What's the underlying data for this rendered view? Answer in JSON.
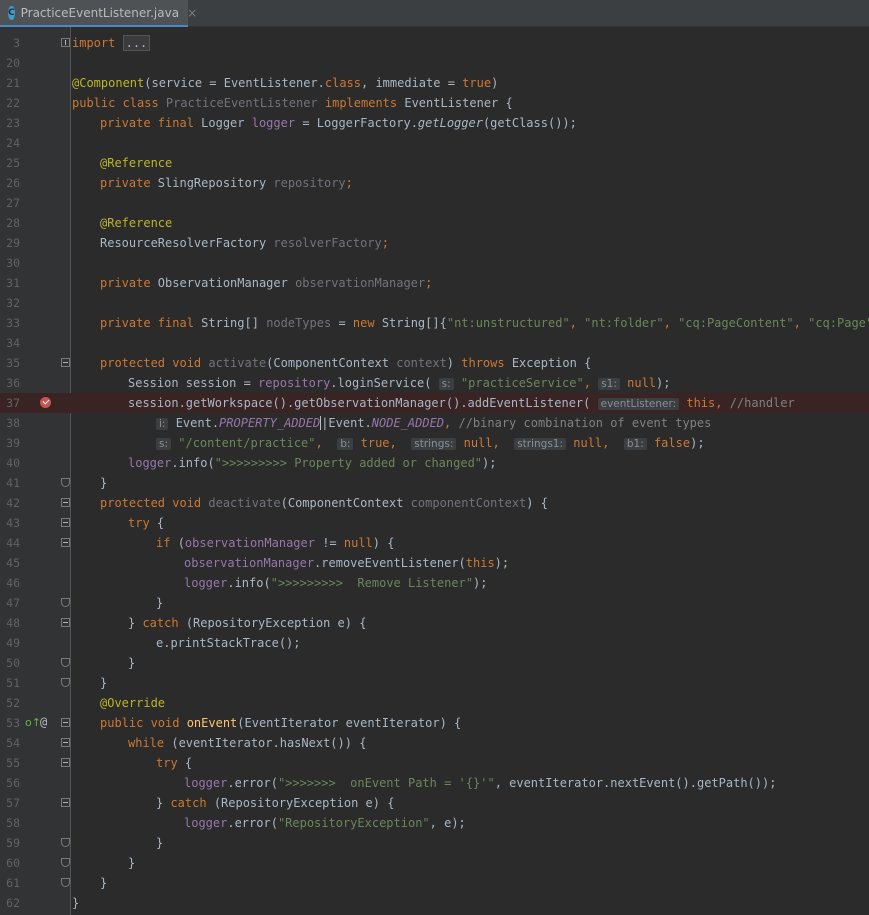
{
  "tab": {
    "icon_letter": "C",
    "filename": "PracticeEventListener.java",
    "close_glyph": "×"
  },
  "colors": {
    "keyword": "#cc7832",
    "annotation": "#bbb529",
    "string": "#6a8759",
    "field": "#9876aa",
    "method_decl": "#ffc66d",
    "comment": "#808080",
    "breakpoint": "#c75450"
  },
  "gutter_icons": {
    "line37": "breakpoint-icon",
    "line53": [
      "implementation-icon",
      "override-icon"
    ]
  },
  "line_numbers": [
    "3",
    "20",
    "21",
    "22",
    "23",
    "24",
    "25",
    "26",
    "27",
    "28",
    "29",
    "30",
    "31",
    "32",
    "33",
    "34",
    "35",
    "36",
    "37",
    "38",
    "39",
    "40",
    "41",
    "42",
    "43",
    "44",
    "45",
    "46",
    "47",
    "48",
    "49",
    "50",
    "51",
    "52",
    "53",
    "54",
    "55",
    "56",
    "57",
    "58",
    "59",
    "60",
    "61",
    "62"
  ],
  "code": {
    "l3": {
      "kw": "import",
      "folded": "..."
    },
    "l21": {
      "ann": "@Component",
      "a": "(service = EventListener.",
      "kw1": "class",
      "b": ", immediate = ",
      "kw2": "true",
      "c": ")"
    },
    "l22": {
      "kw1": "public class ",
      "cls": "PracticeEventListener",
      "kw2": " implements ",
      "rest": "EventListener {"
    },
    "l23": {
      "kw": "private final ",
      "a": "Logger ",
      "fld": "logger",
      "b": " = LoggerFactory.",
      "itl": "getLogger",
      "c": "(getClass());"
    },
    "l25": {
      "ann": "@Reference"
    },
    "l26": {
      "kw": "private ",
      "a": "SlingRepository ",
      "unused": "repository",
      "b": ";"
    },
    "l28": {
      "ann": "@Reference"
    },
    "l29": {
      "a": "ResourceResolverFactory ",
      "unused": "resolverFactory",
      "b": ";"
    },
    "l31": {
      "kw": "private ",
      "a": "ObservationManager ",
      "unused": "observationManager",
      "b": ";"
    },
    "l33": {
      "kw1": "private final ",
      "a": "String[] ",
      "unused": "nodeTypes",
      "b": " = ",
      "kw2": "new ",
      "c": "String[]{",
      "s1": "\"nt:unstructured\"",
      "d": ", ",
      "s2": "\"nt:folder\"",
      "e": ", ",
      "s3": "\"cq:PageContent\"",
      "f": ", ",
      "s4": "\"cq:Page\"",
      "g": "};"
    },
    "l35": {
      "kw1": "protected void ",
      "unused1": "activate",
      "a": "(ComponentContext ",
      "unused2": "context",
      "b": ") ",
      "kw2": "throws ",
      "c": "Exception {"
    },
    "l36": {
      "a": "Session session = ",
      "fld": "repository",
      "b": ".loginService( ",
      "h1": "s:",
      "s1": " \"practiceService\"",
      "c": ", ",
      "h2": "s1:",
      "kw": " null",
      "d": ");"
    },
    "l37": {
      "a": "session.getWorkspace().getObservationManager().addEventListener( ",
      "h1": "eventListener:",
      "kw": " this",
      "b": ", ",
      "cmt": "//handler"
    },
    "l38": {
      "h1": "i:",
      "a": " Event.",
      "fld1": "PROPERTY_ADDED",
      "b": "|Event.",
      "fld2": "NODE_ADDED",
      "c": ", ",
      "cmt": "//binary combination of event types"
    },
    "l39": {
      "h1": "s:",
      "s1": " \"/content/practice\"",
      "a": ",  ",
      "h2": "b:",
      "kw1": " true",
      "b": ",  ",
      "h3": "strings:",
      "kw2": " null",
      "c": ",  ",
      "h4": "strings1:",
      "kw3": " null",
      "d": ",  ",
      "h5": "b1:",
      "kw4": " false",
      "e": ");"
    },
    "l40": {
      "fld": "logger",
      "a": ".info(",
      "s1": "\">>>>>>>>> Property added or changed\"",
      "b": ");"
    },
    "l41": {
      "a": "}"
    },
    "l42": {
      "kw": "protected void ",
      "unused1": "deactivate",
      "a": "(ComponentContext ",
      "unused2": "componentContext",
      "b": ") {"
    },
    "l43": {
      "kw": "try ",
      "a": "{"
    },
    "l44": {
      "kw1": "if ",
      "a": "(",
      "fld": "observationManager",
      "b": " != ",
      "kw2": "null",
      "c": ") {"
    },
    "l45": {
      "fld": "observationManager",
      "a": ".removeEventListener(",
      "kw": "this",
      "b": ");"
    },
    "l46": {
      "fld": "logger",
      "a": ".info(",
      "s1": "\">>>>>>>>>  Remove Listener\"",
      "b": ");"
    },
    "l47": {
      "a": "}"
    },
    "l48": {
      "a": "} ",
      "kw": "catch ",
      "b": "(RepositoryException e) {"
    },
    "l49": {
      "a": "e.printStackTrace();"
    },
    "l50": {
      "a": "}"
    },
    "l51": {
      "a": "}"
    },
    "l52": {
      "ann": "@Override"
    },
    "l53": {
      "kw": "public void ",
      "mth": "onEvent",
      "a": "(EventIterator eventIterator) {"
    },
    "l54": {
      "kw": "while ",
      "a": "(eventIterator.hasNext()) {"
    },
    "l55": {
      "kw": "try ",
      "a": "{"
    },
    "l56": {
      "fld": "logger",
      "a": ".error(",
      "s1": "\">>>>>>>  onEvent Path = '{}'\"",
      "b": ", eventIterator.nextEvent().getPath());"
    },
    "l57": {
      "a": "} ",
      "kw": "catch ",
      "b": "(RepositoryException e) {"
    },
    "l58": {
      "fld": "logger",
      "a": ".error(",
      "s1": "\"RepositoryException\"",
      "b": ", e);"
    },
    "l59": {
      "a": "}"
    },
    "l60": {
      "a": "}"
    },
    "l61": {
      "a": "}"
    },
    "l62": {
      "a": "}"
    }
  }
}
